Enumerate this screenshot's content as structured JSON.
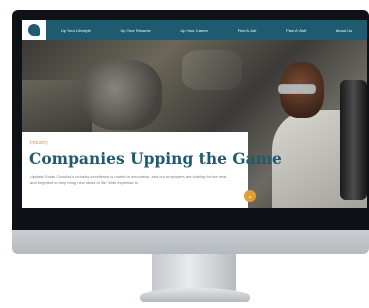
{
  "nav": {
    "items": [
      {
        "label": "Up Your Lifestyle"
      },
      {
        "label": "Up Your Resume"
      },
      {
        "label": "Up Your Career"
      },
      {
        "label": "Find A Job"
      },
      {
        "label": "Plan A Visit"
      },
      {
        "label": "About Us"
      }
    ]
  },
  "hero": {
    "category": "Industry",
    "headline": "Companies Upping the Game",
    "body": "Upstate South Carolina's industry excellence is rooted in innovation, and our employers are looking for the best and brightest to help bring new ideas to life. With expertise in"
  },
  "scroll_icon": "chevron-down-icon",
  "colors": {
    "brand": "#1e5b70",
    "accent": "#e0a030"
  }
}
